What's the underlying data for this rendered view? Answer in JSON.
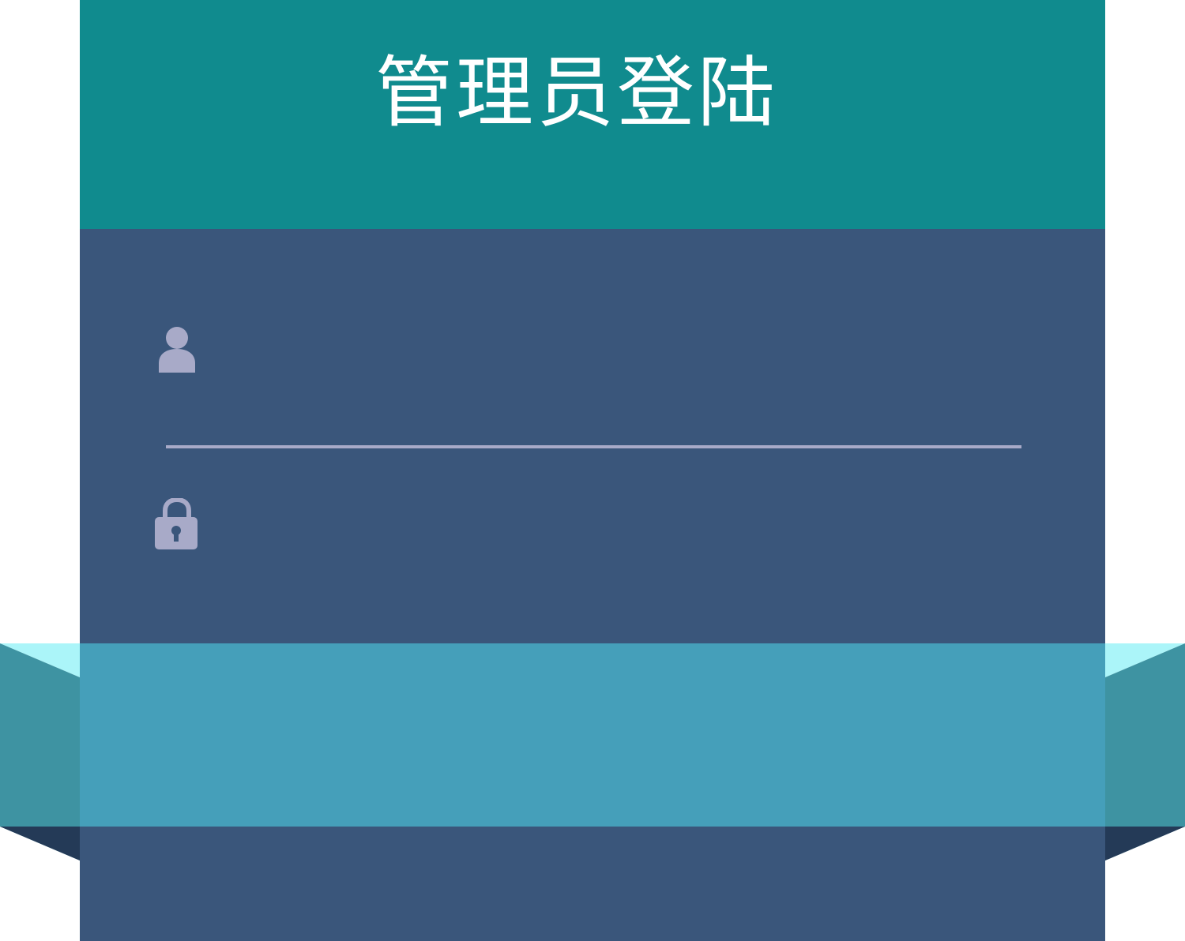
{
  "login": {
    "title": "管理员登陆",
    "username_field": {
      "icon": "user-icon",
      "value": "",
      "placeholder": ""
    },
    "password_field": {
      "icon": "lock-icon",
      "value": "",
      "placeholder": ""
    },
    "submit": {
      "label": ""
    }
  },
  "colors": {
    "header": "#108b8e",
    "card": "#3a567b",
    "ribbon": "#459fba",
    "ribbon_side": "#3e93a2",
    "ribbon_top_fold": "#abf5f9",
    "ribbon_bottom_fold": "#243a57",
    "icon": "#a8aac8",
    "title": "#ffffff"
  }
}
